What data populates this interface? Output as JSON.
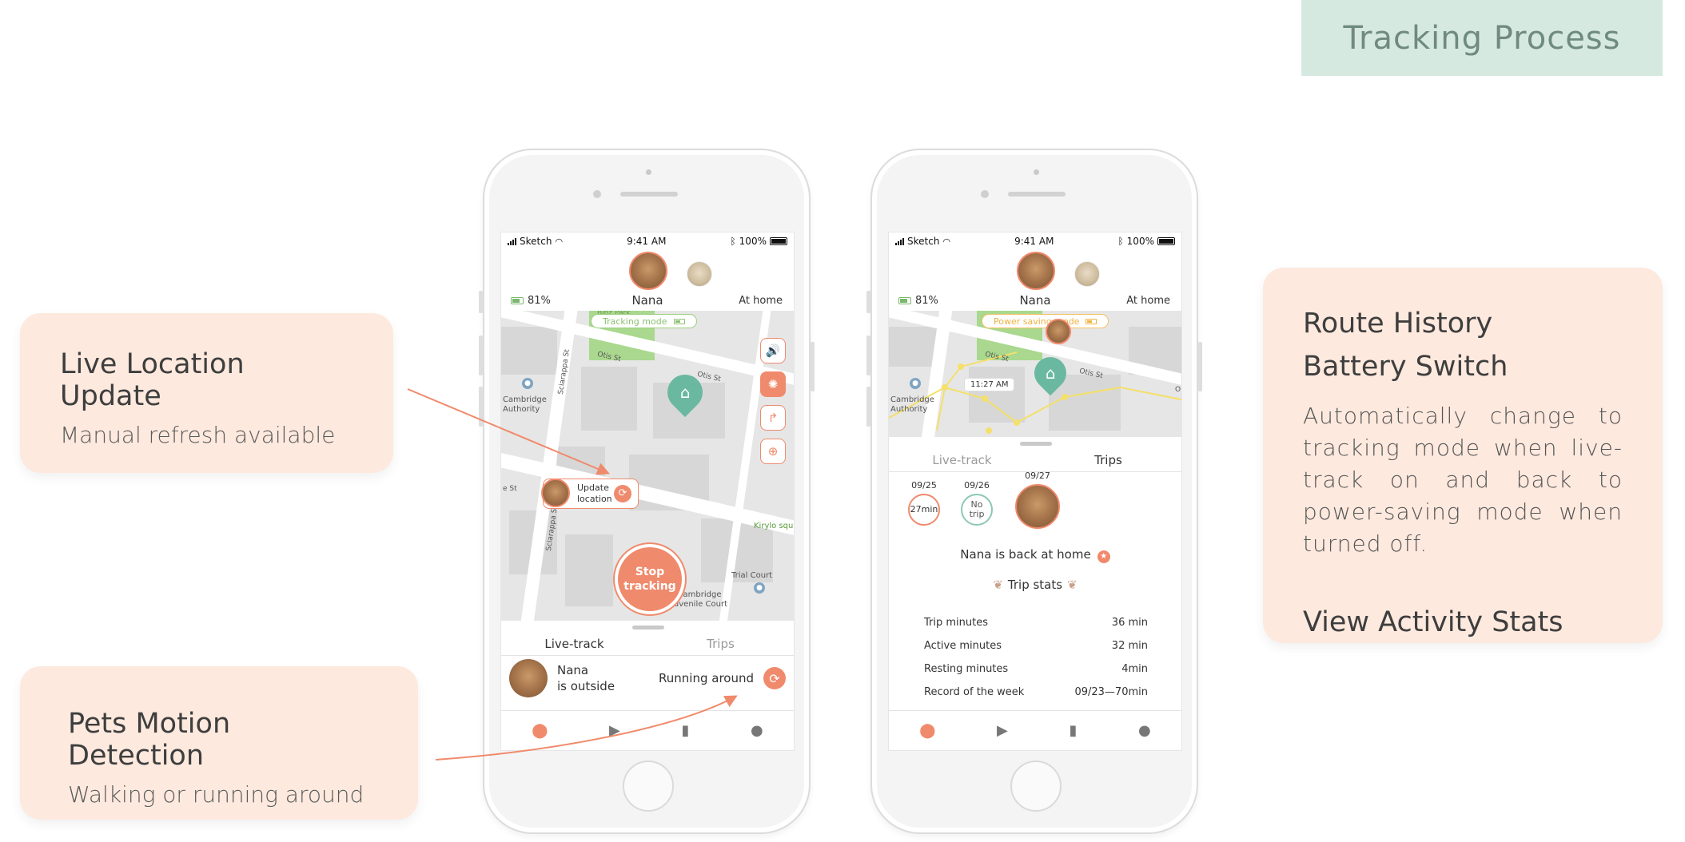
{
  "header": {
    "title": "Tracking Process"
  },
  "annotations": {
    "live_location": {
      "title": "Live Location Update",
      "subtitle": "Manual refresh available"
    },
    "motion": {
      "title": "Pets Motion Detection",
      "subtitle": "Walking or running around"
    },
    "route": {
      "title_1": "Route History",
      "title_2": "Battery Switch",
      "description": "Automatically change to tracking mode when live-track on and back to power-saving mode when turned off.",
      "title_3": "View Activity Stats"
    }
  },
  "status_bar": {
    "carrier": "Sketch",
    "time": "9:41 AM",
    "battery": "100%"
  },
  "pet": {
    "name": "Nana",
    "battery": "81%",
    "location_status": "At home"
  },
  "phone1": {
    "mode_pill": "Tracking mode",
    "update_location": "Update location",
    "stop_tracking": "Stop tracking",
    "streets": {
      "otis_1": "Otis St",
      "otis_2": "Otis St",
      "sciarappa_1": "Sciarappa St",
      "sciarappa_2": "Sciarappa St",
      "e_st": "e St",
      "kirylo": "Kirylo squ",
      "cambridge_auth": "Cambridge Authority",
      "trial_court": "Trial Court",
      "juvenile": "Cambridge Juvenile Court",
      "park": "Binz Park"
    },
    "tabs": {
      "live": "Live-track",
      "trips": "Trips"
    },
    "live_panel": {
      "name": "Nana",
      "location": "is outside",
      "activity": "Running around"
    }
  },
  "phone2": {
    "mode_pill": "Power saving mode",
    "time_label": "11:27 AM",
    "streets": {
      "otis_1": "Otis St",
      "otis_2": "Otis St",
      "cambridge_auth": "Cambridge Authority",
      "o": "O"
    },
    "tabs": {
      "live": "Live-track",
      "trips": "Trips"
    },
    "dates": [
      {
        "date": "09/25",
        "value": "27min"
      },
      {
        "date": "09/26",
        "value": "No trip"
      },
      {
        "date": "09/27",
        "value": ""
      }
    ],
    "back_home": "Nana is back at home",
    "trip_stats_title": "Trip stats",
    "stats": [
      {
        "label": "Trip minutes",
        "value": "36 min"
      },
      {
        "label": "Active minutes",
        "value": "32 min"
      },
      {
        "label": "Resting minutes",
        "value": "4min"
      },
      {
        "label": "Record of the week",
        "value": "09/23—70min"
      }
    ]
  },
  "nav_icons": [
    "location-icon",
    "video-icon",
    "stats-icon",
    "profile-icon"
  ],
  "colors": {
    "accent": "#f08a6c",
    "card_bg": "#fde9de",
    "header_bg": "#d6e9e1",
    "home_pin": "#6ab8a0",
    "tracking_green": "#8cc171",
    "power_yellow": "#f0b23f"
  }
}
